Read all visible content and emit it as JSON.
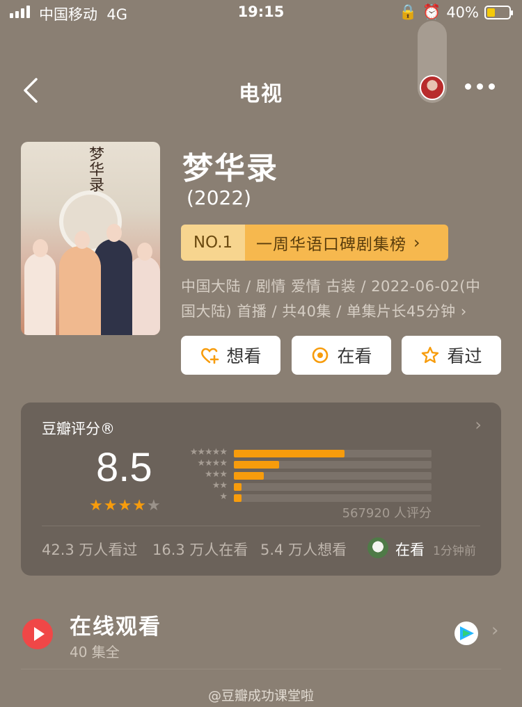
{
  "status_bar": {
    "carrier": "中国移动",
    "network": "4G",
    "time": "19:15",
    "battery_percent": "40%",
    "battery_level": 0.4
  },
  "nav": {
    "title": "电视"
  },
  "movie": {
    "title": "梦华录",
    "year": "(2022)",
    "rank_no": "NO.1",
    "rank_name": "一周华语口碑剧集榜",
    "meta": "中国大陆 / 剧情 爱情 古装 / 2022-06-02(中国大陆) 首播 / 共40集 / 单集片长45分钟",
    "poster_title": "梦华录"
  },
  "actions": {
    "want": "想看",
    "watching": "在看",
    "watched": "看过"
  },
  "rating": {
    "label": "豆瓣评分®",
    "score": "8.5",
    "stars": 4,
    "count": "567920 人评分",
    "distribution": [
      0.56,
      0.23,
      0.15,
      0.04,
      0.04
    ],
    "levels": [
      "★★★★★",
      "★★★★",
      "★★★",
      "★★",
      "★"
    ],
    "watched": "42.3 万人看过",
    "watching": "16.3 万人在看",
    "want": "5.4 万人想看",
    "friend_status": "在看",
    "friend_time": "1分钟前"
  },
  "online": {
    "title": "在线观看",
    "subtitle": "40 集全"
  },
  "watermark": "@豆瓣成功课堂啦",
  "colors": {
    "background": "#8a7f73",
    "accent": "#f79c0c",
    "rank_badge": "#f6b84e",
    "play": "#f04747"
  }
}
